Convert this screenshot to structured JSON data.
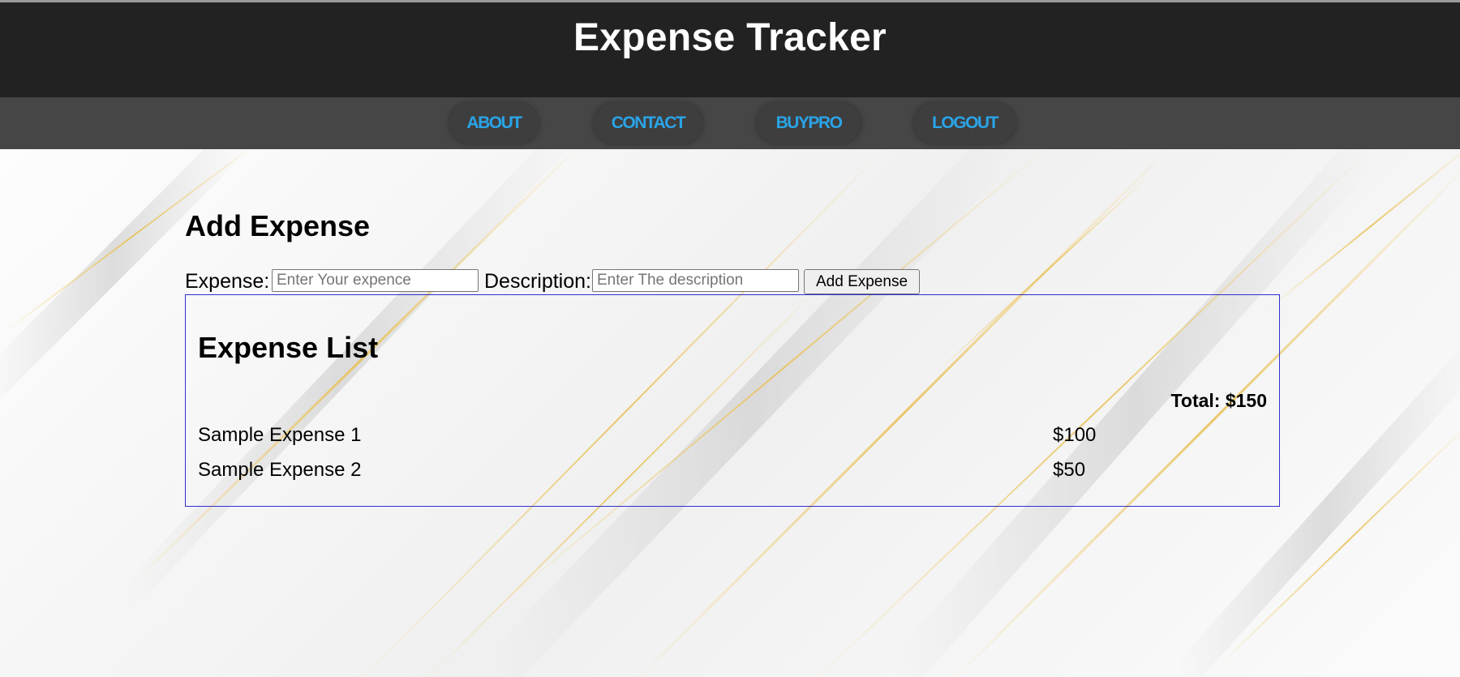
{
  "header": {
    "title": "Expense Tracker"
  },
  "nav": {
    "items": [
      {
        "label": "ABOUT"
      },
      {
        "label": "CONTACT"
      },
      {
        "label": "BUYPRO"
      },
      {
        "label": "LOGOUT"
      }
    ]
  },
  "form": {
    "title": "Add Expense",
    "expense_label": "Expense:",
    "expense_placeholder": "Enter Your expence",
    "expense_value": "",
    "description_label": "Description:",
    "description_placeholder": "Enter The description",
    "description_value": "",
    "submit_label": "Add Expense"
  },
  "expense_list": {
    "title": "Expense List",
    "total": "Total: $150",
    "items": [
      {
        "name": "Sample Expense 1",
        "amount": "$100"
      },
      {
        "name": "Sample Expense 2",
        "amount": "$50"
      }
    ]
  },
  "colors": {
    "header_bg": "#222222",
    "nav_bg": "#464646",
    "nav_link": "#2aa4e8",
    "list_border": "#2f2fcf"
  }
}
